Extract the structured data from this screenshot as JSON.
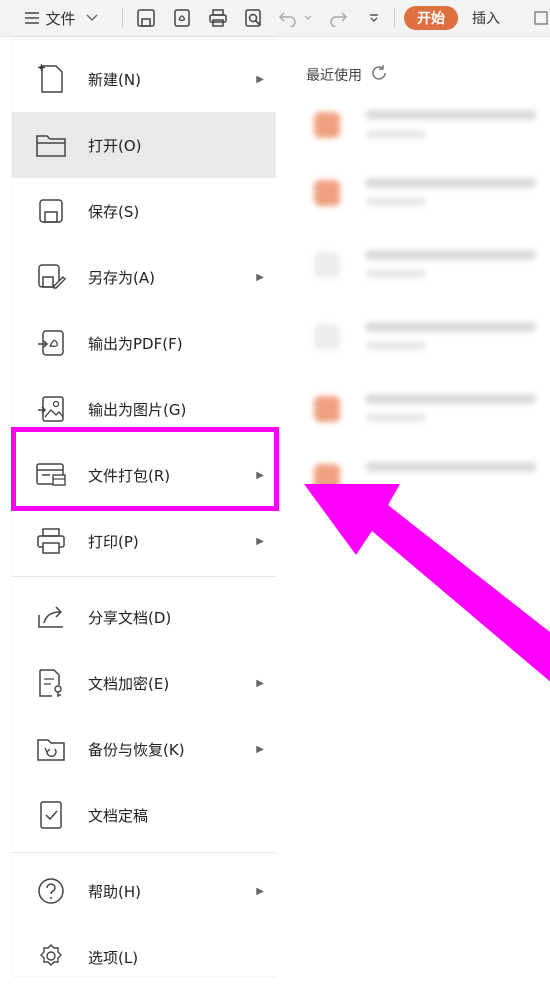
{
  "toolbar": {
    "file_label": "文件",
    "start_tab": "开始",
    "insert_tab": "插入",
    "icons": [
      "menu-icon",
      "chevron-down-icon",
      "save-icon",
      "export-pdf-icon",
      "print-icon",
      "print-preview-icon",
      "undo-icon",
      "redo-icon",
      "customize-icon"
    ]
  },
  "menu": {
    "items": [
      {
        "label": "新建(N)",
        "icon": "new-file-icon",
        "has_submenu": true
      },
      {
        "label": "打开(O)",
        "icon": "open-folder-icon",
        "has_submenu": false
      },
      {
        "label": "保存(S)",
        "icon": "save-icon",
        "has_submenu": false
      },
      {
        "label": "另存为(A)",
        "icon": "save-as-icon",
        "has_submenu": true
      },
      {
        "label": "输出为PDF(F)",
        "icon": "export-pdf-icon",
        "has_submenu": false
      },
      {
        "label": "输出为图片(G)",
        "icon": "export-image-icon",
        "has_submenu": false
      },
      {
        "label": "文件打包(R)",
        "icon": "package-icon",
        "has_submenu": true
      },
      {
        "label": "打印(P)",
        "icon": "print-icon",
        "has_submenu": true
      },
      {
        "label": "分享文档(D)",
        "icon": "share-icon",
        "has_submenu": false
      },
      {
        "label": "文档加密(E)",
        "icon": "encrypt-icon",
        "has_submenu": true
      },
      {
        "label": "备份与恢复(K)",
        "icon": "backup-icon",
        "has_submenu": true
      },
      {
        "label": "文档定稿",
        "icon": "finalize-icon",
        "has_submenu": false
      },
      {
        "label": "帮助(H)",
        "icon": "help-icon",
        "has_submenu": true
      },
      {
        "label": "选项(L)",
        "icon": "settings-icon",
        "has_submenu": false
      }
    ],
    "hover_item": "打开(O)",
    "highlighted_item": "文件打包(R)"
  },
  "recent": {
    "title": "最近使用"
  },
  "colors": {
    "accent": "#e0703f",
    "highlight": "#ff00ff",
    "hover_bg": "#e9e9e9"
  }
}
